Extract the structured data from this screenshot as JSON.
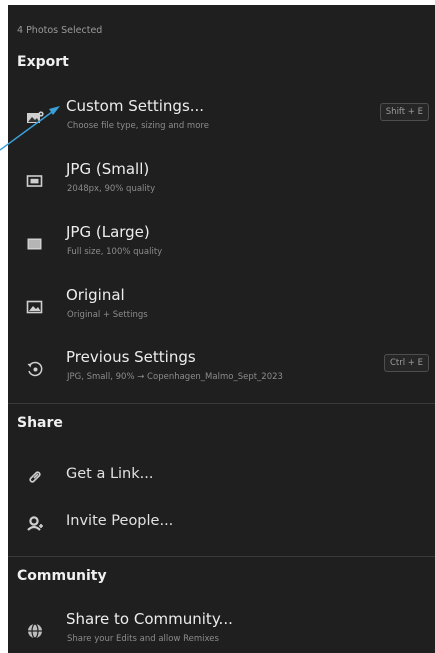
{
  "selection_label": "4 Photos Selected",
  "export": {
    "title": "Export",
    "items": [
      {
        "title": "Custom Settings...",
        "subtitle": "Choose file type, sizing and more",
        "shortcut": "Shift + E",
        "icon": "custom-settings-icon"
      },
      {
        "title": "JPG (Small)",
        "subtitle": "2048px, 90% quality",
        "icon": "jpg-small-icon"
      },
      {
        "title": "JPG (Large)",
        "subtitle": "Full size, 100% quality",
        "icon": "jpg-large-icon"
      },
      {
        "title": "Original",
        "subtitle": "Original + Settings",
        "icon": "image-icon"
      },
      {
        "title": "Previous Settings",
        "subtitle": "JPG, Small, 90% → Copenhagen_Malmo_Sept_2023",
        "shortcut": "Ctrl + E",
        "icon": "history-icon"
      }
    ]
  },
  "share": {
    "title": "Share",
    "items": [
      {
        "title": "Get a Link...",
        "icon": "link-icon"
      },
      {
        "title": "Invite People...",
        "icon": "invite-people-icon"
      }
    ]
  },
  "community": {
    "title": "Community",
    "items": [
      {
        "title": "Share to Community...",
        "subtitle": "Share your Edits and allow Remixes",
        "icon": "globe-icon"
      }
    ]
  },
  "colors": {
    "panel_bg": "#1f1f1f",
    "text": "#ededed",
    "muted": "#8c8c8c",
    "annotation_arrow": "#3aa0d8"
  }
}
